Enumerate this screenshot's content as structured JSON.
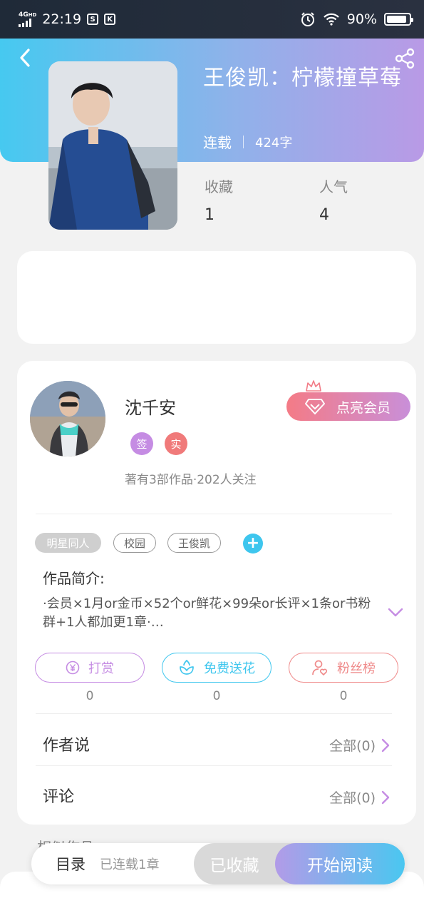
{
  "status_bar": {
    "network": "4G",
    "network_sup": "HD",
    "time": "22:19",
    "icon1": "S",
    "icon2": "K",
    "battery": "90%",
    "battery_level": 0.9
  },
  "book": {
    "title": "王俊凯：柠檬撞草莓",
    "status": "连载",
    "word_count": "424字",
    "favorites_label": "收藏",
    "favorites_value": "1",
    "popularity_label": "人气",
    "popularity_value": "4"
  },
  "author": {
    "name": "沈千安",
    "badge_sign": "签",
    "badge_real": "实",
    "stats": "著有3部作品·202人关注",
    "vip_button": "点亮会员"
  },
  "tags": {
    "active": "明星同人",
    "items": [
      "校园",
      "王俊凯"
    ],
    "add": "+"
  },
  "intro": {
    "heading": "作品简介:",
    "text": "·会员×1月or金币×52个or鲜花×99朵or长评×1条or书粉群+1人都加更1章·…"
  },
  "actions": [
    {
      "label": "打赏",
      "count": "0"
    },
    {
      "label": "免费送花",
      "count": "0"
    },
    {
      "label": "粉丝榜",
      "count": "0"
    }
  ],
  "rows": {
    "author_says": "作者说",
    "author_says_right": "全部(0)",
    "comments": "评论",
    "comments_right": "全部(0)"
  },
  "peek_text": "相似作品",
  "bottom": {
    "toc": "目录",
    "toc_sub": "已连载1章",
    "saved": "已收藏",
    "read": "开始阅读"
  },
  "colors": {
    "banner_start": "#46c9f0",
    "banner_end": "#b99ae6",
    "purple": "#c58ce3",
    "cyan": "#3ec6ee",
    "coral": "#ef8a8a"
  }
}
